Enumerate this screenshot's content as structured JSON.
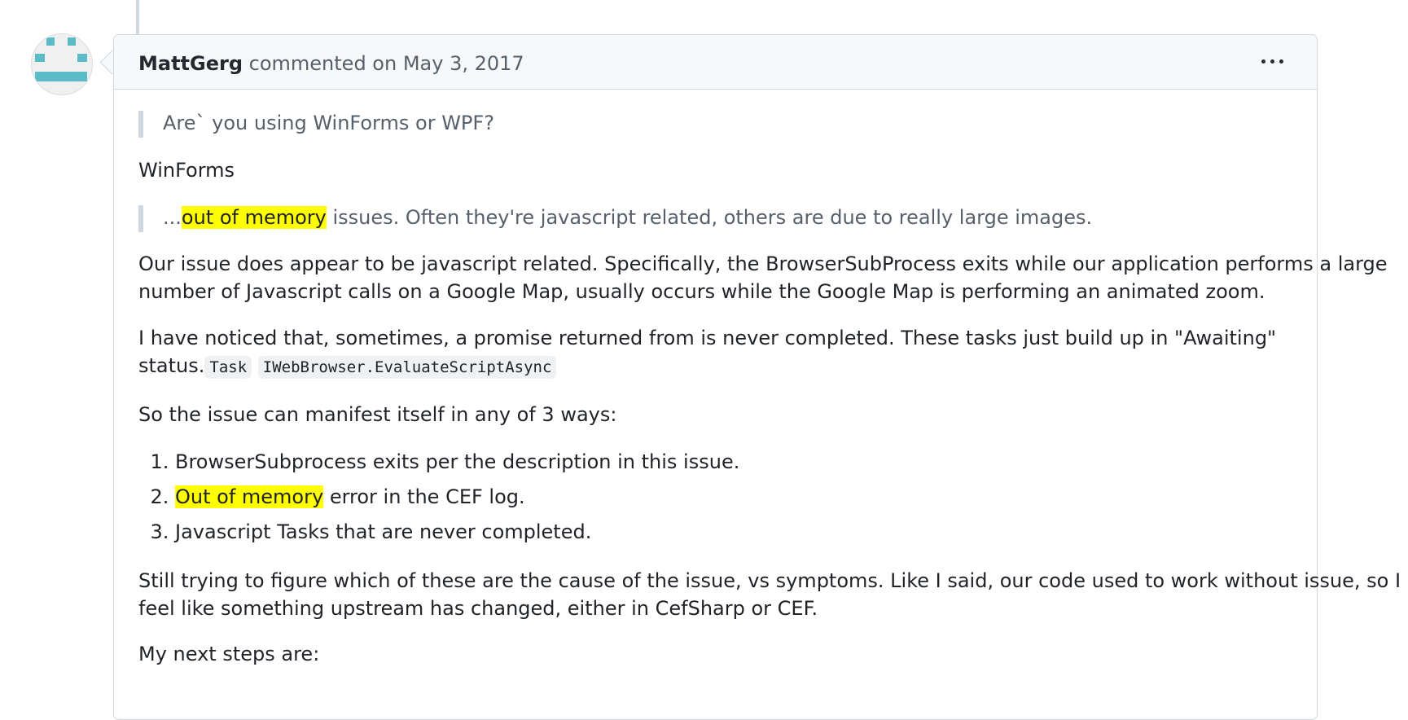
{
  "comment": {
    "author": "MattGerg",
    "action_text": "commented on May 3, 2017",
    "menu_icon": "kebab-horizontal-icon",
    "quote1": "Are` you using WinForms or WPF?",
    "answer1": "WinForms",
    "quote2": {
      "prefix": "...",
      "highlight": "out of memory",
      "rest": " issues. Often they're javascript related, others are due to really large images."
    },
    "para1_line1": "Our issue does appear to be javascript related. Specifically, the BrowserSubProcess exits while our application performs a large",
    "para1_line2": "number of Javascript calls on a Google Map, usually occurs while the Google Map is performing an animated zoom.",
    "para2_line1": "I have noticed that, sometimes, a promise returned from is never completed. These tasks just build up in \"Awaiting\"",
    "para2_line2_text": "status.",
    "code1": "Task",
    "code2": "IWebBrowser.EvaluateScriptAsync",
    "para3": "So the issue can manifest itself in any of 3 ways:",
    "list": {
      "item1": "BrowserSubprocess exits per the description in this issue.",
      "item2_highlight": "Out of memory",
      "item2_rest": " error in the CEF log.",
      "item3": "Javascript Tasks that are never completed."
    },
    "para4_line1": "Still trying to figure which of these are the cause of the issue, vs symptoms. Like I said, our code used to work without issue, so I",
    "para4_line2": "feel like something upstream has changed, either in CefSharp or CEF.",
    "para5": "My next steps are:"
  },
  "colors": {
    "highlight": "#ffff00",
    "avatar_accent": "#5bbcc8",
    "header_bg": "#f6f8fa",
    "border": "#d0d7de"
  }
}
